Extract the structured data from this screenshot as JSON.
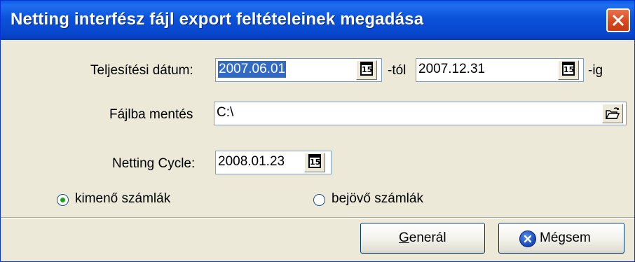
{
  "window": {
    "title": "Netting interfész fájl export feltételeinek megadása"
  },
  "form": {
    "date_label": "Teljesítési dátum:",
    "date_from": "2007.06.01",
    "from_suffix": "-tól",
    "date_to": "2007.12.31",
    "to_suffix": "-ig",
    "file_label": "Fájlba mentés",
    "file_path": "C:\\",
    "cycle_label": "Netting Cycle:",
    "cycle_date": "2008.01.23",
    "calendar_icon_text": "15"
  },
  "options": [
    {
      "label": "kimenő számlák",
      "selected": true
    },
    {
      "label": "bejövő számlák",
      "selected": false
    }
  ],
  "buttons": {
    "generate_label_mnemonic": "G",
    "generate_label_rest": "enerál",
    "cancel_label": "Mégsem"
  },
  "colors": {
    "titlebar": "#0a52d9",
    "selection": "#316ac5",
    "close": "#d8491f",
    "radio_dot": "#21a121"
  },
  "icons": [
    "close-icon",
    "calendar-icon",
    "open-folder-icon",
    "cancel-x-icon"
  ]
}
